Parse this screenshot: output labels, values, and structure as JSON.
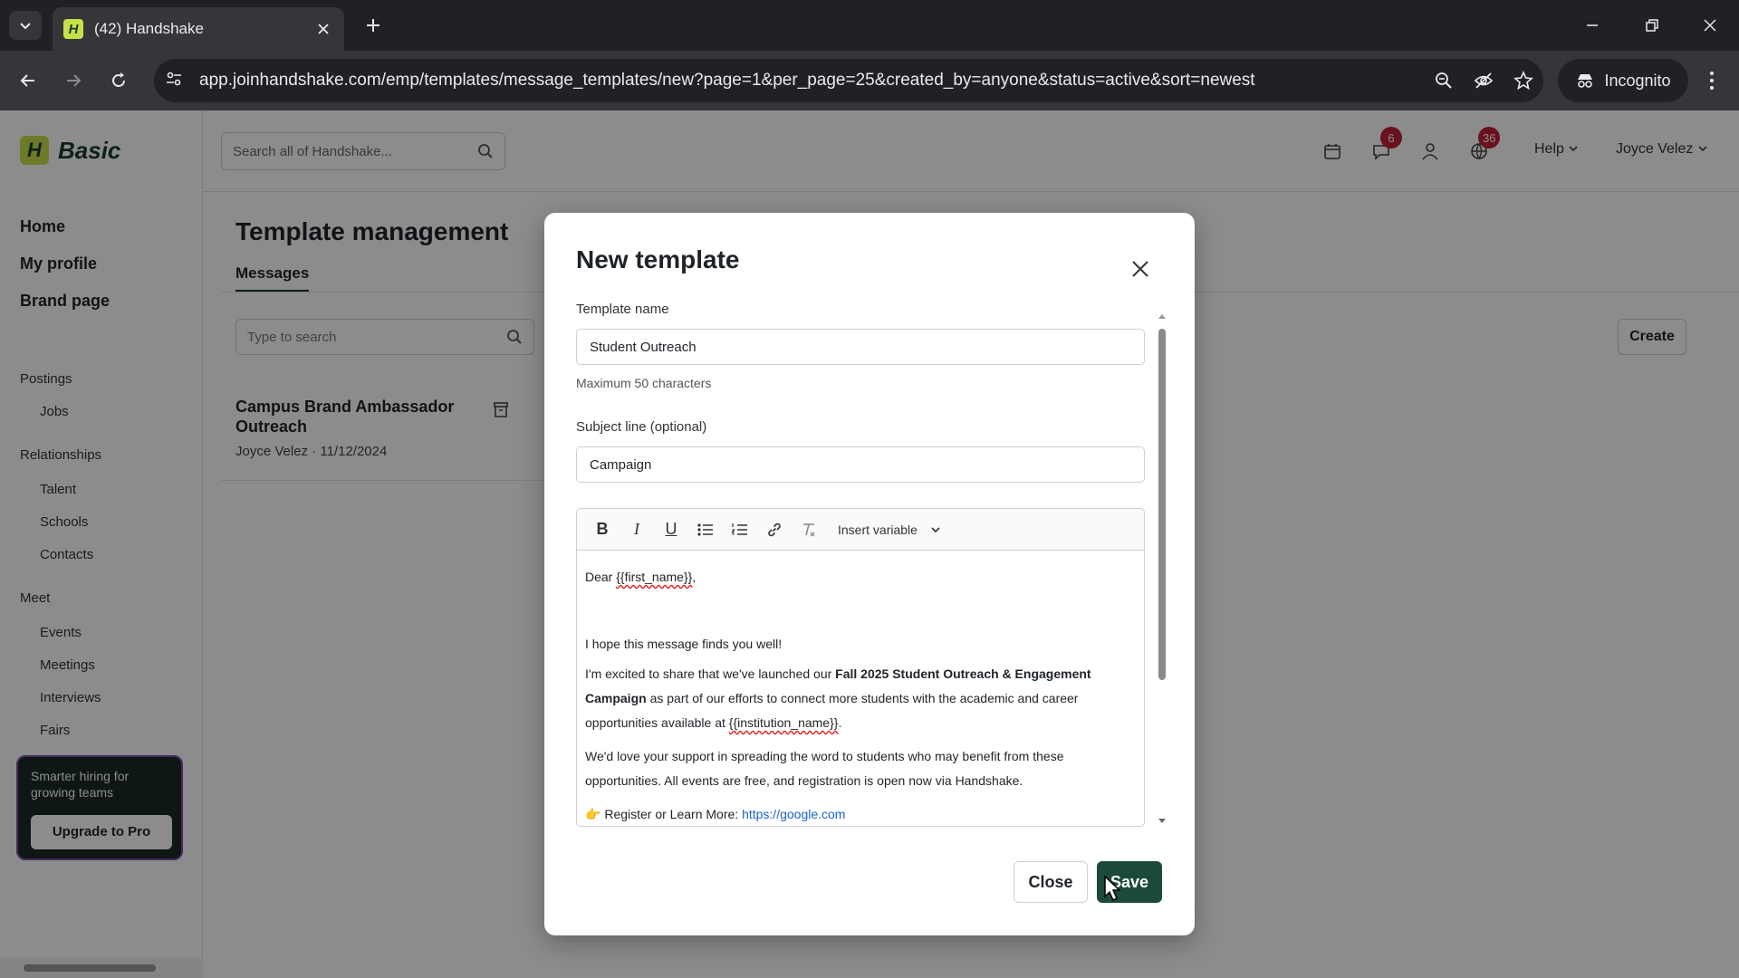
{
  "browser": {
    "tab_title": "(42) Handshake",
    "favicon_letter": "H",
    "url": "app.joinhandshake.com/emp/templates/message_templates/new?page=1&per_page=25&created_by=anyone&status=active&sort=newest",
    "incognito_label": "Incognito"
  },
  "app": {
    "logo_letter": "H",
    "logo_text": "Basic",
    "nav_main": [
      "Home",
      "My profile",
      "Brand page"
    ],
    "nav_sections": {
      "postings": "Postings",
      "jobs": "Jobs",
      "relationships": "Relationships",
      "talent": "Talent",
      "schools": "Schools",
      "contacts": "Contacts",
      "meet": "Meet",
      "events": "Events",
      "meetings": "Meetings",
      "interviews": "Interviews",
      "fairs": "Fairs"
    },
    "promo": {
      "text": "Smarter hiring for growing teams",
      "button": "Upgrade to Pro"
    },
    "top_search_placeholder": "Search all of Handshake...",
    "badges": {
      "messages": "6",
      "globe": "36"
    },
    "help_label": "Help",
    "user_name": "Joyce Velez",
    "page_title": "Template management",
    "tab_messages": "Messages",
    "list_search_placeholder": "Type to search",
    "create_label": "Create",
    "list_item": {
      "title": "Campus Brand Ambassador Outreach",
      "meta": "Joyce Velez · 11/12/2024"
    }
  },
  "modal": {
    "title": "New template",
    "template_name_label": "Template name",
    "template_name_value": "Student Outreach",
    "template_name_help": "Maximum 50 characters",
    "subject_label": "Subject line (optional)",
    "subject_value": "Campaign",
    "insert_variable_label": "Insert variable",
    "body": {
      "greeting_prefix": "Dear ",
      "greeting_var": "{{first_name}}",
      "greeting_suffix": ",",
      "p1": "I hope this message finds you well!",
      "p2_a": "I'm excited to share that we've launched our ",
      "p2_bold": "Fall 2025 Student Outreach & Engagement Campaign",
      "p2_b": " as part of our efforts to connect more students with the academic and career opportunities available at ",
      "p2_var": "{{institution_name}}",
      "p2_c": ".",
      "p3": "We'd love your support in spreading the word to students who may benefit from these opportunities. All events are free, and registration is open now via Handshake.",
      "p4_emoji": "👉",
      "p4_label": " Register or Learn More: ",
      "p4_link": "https://google.com"
    },
    "close_label": "Close",
    "save_label": "Save"
  }
}
